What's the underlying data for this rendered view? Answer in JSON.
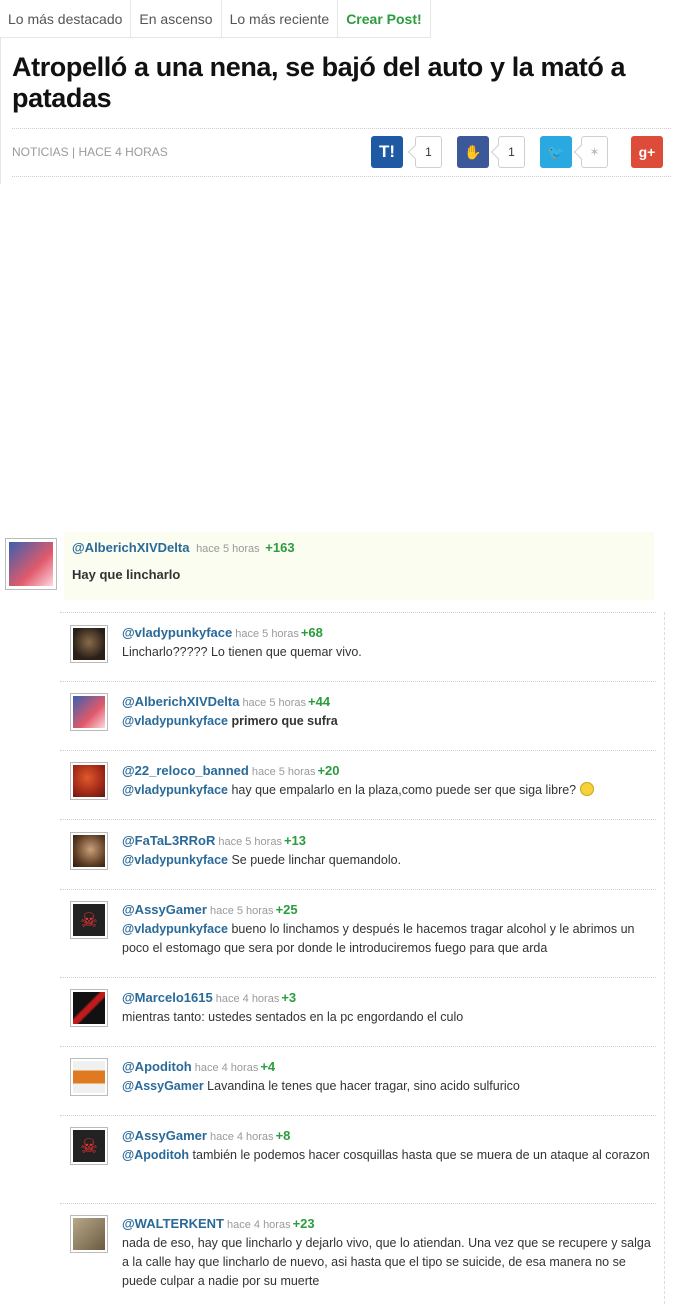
{
  "nav": {
    "tabs": [
      "Lo más destacado",
      "En ascenso",
      "Lo más reciente"
    ],
    "create": "Crear Post!"
  },
  "post": {
    "title": "Atropelló a una nena, se bajó del auto y la mató a patadas",
    "meta": "NOTICIAS | HACE 4 HORAS"
  },
  "share": {
    "taringa": {
      "label": "T!",
      "count": "1",
      "color": "#1d5aa3"
    },
    "like": {
      "label": "👍",
      "count": "1",
      "color": "#3b5998"
    },
    "twitter": {
      "label": "🐦",
      "count": "",
      "color": "#2aa9e0"
    },
    "gplus": {
      "label": "g+",
      "color": "#dd4b39"
    }
  },
  "comments": [
    {
      "user": "@AlberichXIVDelta",
      "time": "hace 5 horas",
      "score": "+163",
      "mention": "",
      "text": "Hay que lincharlo",
      "avatar_color": "#3a5fb0"
    },
    {
      "user": "@vladypunkyface",
      "time": "hace 5 horas",
      "score": "+68",
      "mention": "",
      "text": "Lincharlo????? Lo tienen que quemar vivo.",
      "avatar_color": "#5a4a3a"
    },
    {
      "user": "@AlberichXIVDelta",
      "time": "hace 5 horas",
      "score": "+44",
      "mention": "@vladypunkyface",
      "text": "primero que sufra",
      "avatar_color": "#3a5fb0"
    },
    {
      "user": "@22_reloco_banned",
      "time": "hace 5 horas",
      "score": "+20",
      "mention": "@vladypunkyface",
      "text": "hay que empalarlo en la plaza,como puede ser que siga libre?",
      "avatar_color": "#c24a2a"
    },
    {
      "user": "@FaTaL3RRoR",
      "time": "hace 5 horas",
      "score": "+13",
      "mention": "@vladypunkyface",
      "text": "Se puede linchar quemandolo.",
      "avatar_color": "#7a5a3a"
    },
    {
      "user": "@AssyGamer",
      "time": "hace 5 horas",
      "score": "+25",
      "mention": "@vladypunkyface",
      "text": "bueno lo linchamos y después le hacemos tragar alcohol y le abrimos un poco el estomago que sera por donde le introduciremos fuego para que arda",
      "avatar_color": "#222222"
    },
    {
      "user": "@Marcelo1615",
      "time": "hace 4 horas",
      "score": "+3",
      "mention": "",
      "text": "mientras tanto: ustedes sentados en la pc engordando el culo",
      "avatar_color": "#b01a1a"
    },
    {
      "user": "@Apoditoh",
      "time": "hace 4 horas",
      "score": "+4",
      "mention": "@AssyGamer",
      "text": "Lavandina le tenes que hacer tragar, sino acido sulfurico",
      "avatar_color": "#e07a20"
    },
    {
      "user": "@AssyGamer",
      "time": "hace 4 horas",
      "score": "+8",
      "mention": "@Apoditoh",
      "text": "también le podemos hacer cosquillas hasta que se muera de un ataque al corazon",
      "avatar_color": "#222222"
    },
    {
      "user": "@WALTERKENT",
      "time": "hace 4 horas",
      "score": "+23",
      "mention": "",
      "text": "nada de eso, hay que lincharlo y dejarlo vivo, que lo atiendan. Una vez que se recupere y salga a la calle hay que lincharlo de nuevo, asi hasta que el tipo se suicide, de esa manera no se puede culpar a nadie por su muerte",
      "avatar_color": "#8a7a5a"
    }
  ]
}
